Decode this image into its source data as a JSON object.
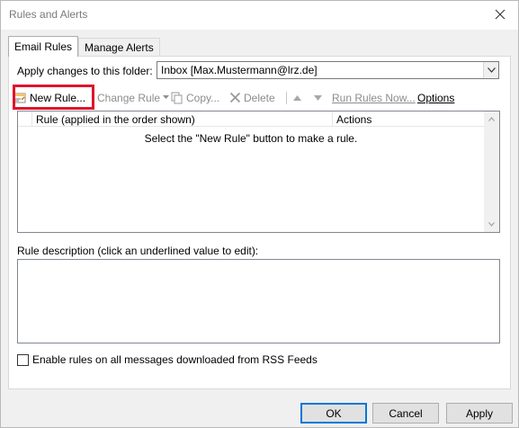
{
  "window": {
    "title": "Rules and Alerts",
    "close_glyph": "✕"
  },
  "tabs": [
    {
      "label": "Email Rules",
      "active": true
    },
    {
      "label": "Manage Alerts",
      "active": false
    }
  ],
  "folder": {
    "label": "Apply changes to this folder:",
    "value": "Inbox [Max.Mustermann@lrz.de]"
  },
  "toolbar": {
    "new_rule": "New Rule...",
    "change_rule": "Change Rule",
    "copy": "Copy...",
    "delete": "Delete",
    "run_rules_now": "Run Rules Now...",
    "options": "Options"
  },
  "rules_list": {
    "columns": [
      "Rule (applied in the order shown)",
      "Actions"
    ],
    "empty_message": "Select the \"New Rule\" button to make a rule."
  },
  "description": {
    "label": "Rule description (click an underlined value to edit):"
  },
  "rss": {
    "label": "Enable rules on all messages downloaded from RSS Feeds",
    "checked": false
  },
  "buttons": {
    "ok": "OK",
    "cancel": "Cancel",
    "apply": "Apply"
  },
  "colors": {
    "highlight": "#e0142d",
    "accent": "#0078d7"
  }
}
